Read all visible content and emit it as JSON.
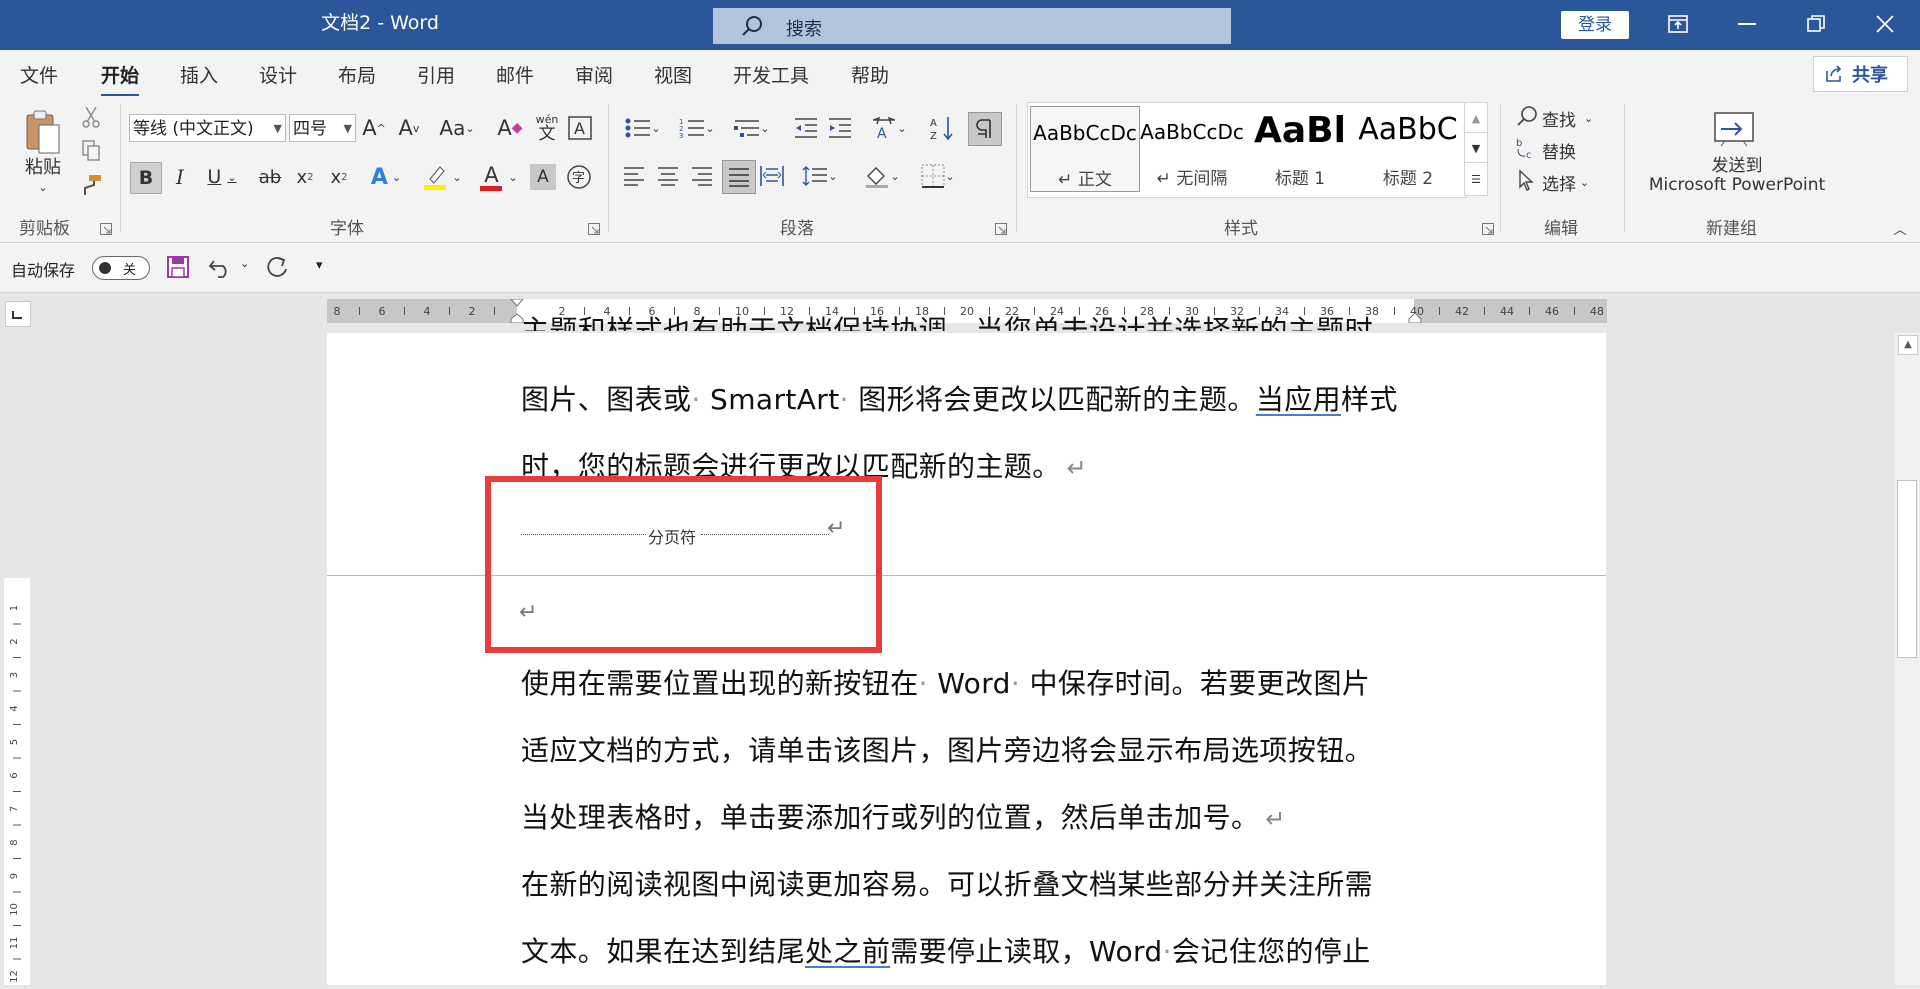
{
  "titlebar": {
    "doc_title": "文档2 - Word",
    "search_placeholder": "搜索",
    "login": "登录"
  },
  "tabs": [
    "文件",
    "开始",
    "插入",
    "设计",
    "布局",
    "引用",
    "邮件",
    "审阅",
    "视图",
    "开发工具",
    "帮助"
  ],
  "active_tab": "开始",
  "share": "共享",
  "ribbon": {
    "clipboard": {
      "paste": "粘贴",
      "label": "剪贴板"
    },
    "font": {
      "family": "等线 (中文正文)",
      "size": "四号",
      "label": "字体",
      "wen": "wén",
      "wen2": "文"
    },
    "paragraph": {
      "label": "段落"
    },
    "styles": {
      "label": "样式",
      "items": [
        {
          "preview": "AaBbCcDc",
          "name": "↵ 正文"
        },
        {
          "preview": "AaBbCcDc",
          "name": "↵ 无间隔"
        },
        {
          "preview": "AaBl",
          "name": "标题 1"
        },
        {
          "preview": "AaBbC",
          "name": "标题 2"
        }
      ]
    },
    "editing": {
      "find": "查找",
      "replace": "替换",
      "select": "选择",
      "label": "编辑"
    },
    "newgroup": {
      "line1": "发送到",
      "line2": "Microsoft PowerPoint",
      "label": "新建组"
    }
  },
  "qat": {
    "autosave": "自动保存",
    "autosave_state": "关"
  },
  "ruler_numbers": [
    "8",
    "6",
    "4",
    "2",
    "2",
    "4",
    "6",
    "8",
    "10",
    "12",
    "14",
    "16",
    "18",
    "20",
    "22",
    "24",
    "26",
    "28",
    "30",
    "32",
    "34",
    "36",
    "38",
    "40",
    "42",
    "44",
    "46",
    "48"
  ],
  "vruler_numbers": [
    "1",
    "2",
    "3",
    "4",
    "5",
    "6",
    "7",
    "8",
    "9",
    "10",
    "11",
    "12"
  ],
  "document": {
    "line_partial": "主题和样式也有助于文档保持协调。当您单击设计并选择新的主题时，",
    "line1_a": "图片、图表或",
    "line1_b": "SmartArt",
    "line1_c": "图形将会更改以匹配新的主题。",
    "line1_d": "当应用",
    "line1_e": "样式",
    "line2": "时，您的标题会进行更改以匹配新的主题。",
    "page_break": "分页符",
    "line3_a": "使用在需要位置出现的新按钮在",
    "line3_b": "Word",
    "line3_c": "中保存时间。若要更改图片",
    "line4": "适应文档的方式，请单击该图片，图片旁边将会显示布局选项按钮。",
    "line5": "当处理表格时，单击要添加行或列的位置，然后单击加号。",
    "line6": "在新的阅读视图中阅读更加容易。可以折叠文档某些部分并关注所需",
    "line7_a": "文本。如果在达到结尾",
    "line7_b": "处之前",
    "line7_c": "需要停止读取，Word",
    "line7_d": "会记住您的停止",
    "pilcrow": "↵",
    "dot": "·"
  },
  "colors": {
    "titlebar": "#2b579a",
    "highlight": "#ea3b3b"
  }
}
